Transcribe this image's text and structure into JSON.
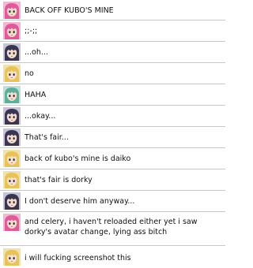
{
  "messages": [
    {
      "avatar": "pink-haired-girl-avatar-icon",
      "text": "BACK OFF KUBO'S MINE"
    },
    {
      "avatar": "pink-haired-girl-avatar-icon",
      "text": ";;-;;"
    },
    {
      "avatar": "dark-haired-boy-avatar-icon",
      "text": "...oh..."
    },
    {
      "avatar": "blonde-girl-avatar-icon",
      "text": "no"
    },
    {
      "avatar": "green-haired-boy-avatar-icon",
      "text": "HAHA"
    },
    {
      "avatar": "dark-haired-boy-avatar-icon",
      "text": "...okay..."
    },
    {
      "avatar": "dark-haired-boy-avatar-icon",
      "text": "That's fair..."
    },
    {
      "avatar": "blonde-girl-avatar-icon",
      "text": "back of kubo's mine is daiko"
    },
    {
      "avatar": "blonde-girl-avatar-icon",
      "text": "that's fair is dorky"
    },
    {
      "avatar": "dark-haired-boy-avatar-icon",
      "text": "I don't deserve him anyway..."
    },
    {
      "avatar": "pink-haired-girl-avatar-icon",
      "text": "and celery, i haven't reloaded either yet i saw dorky's avatar change, lying ass bitch"
    },
    {
      "avatar": "blonde-girl-avatar-icon",
      "text": "i will fucking screenshot this"
    }
  ],
  "avatar_colors": {
    "pink-haired-girl-avatar-icon": {
      "hair": "#e05a9a",
      "skin": "#f6dcc8",
      "bg": "#f2b8d0"
    },
    "dark-haired-boy-avatar-icon": {
      "hair": "#3a3550",
      "skin": "#f3dccb",
      "bg": "#c9c3d8"
    },
    "blonde-girl-avatar-icon": {
      "hair": "#e8c25a",
      "skin": "#f7e1c9",
      "bg": "#f0e2b0"
    },
    "green-haired-boy-avatar-icon": {
      "hair": "#5fae9a",
      "skin": "#f4dfcc",
      "bg": "#bfe0d6"
    }
  }
}
